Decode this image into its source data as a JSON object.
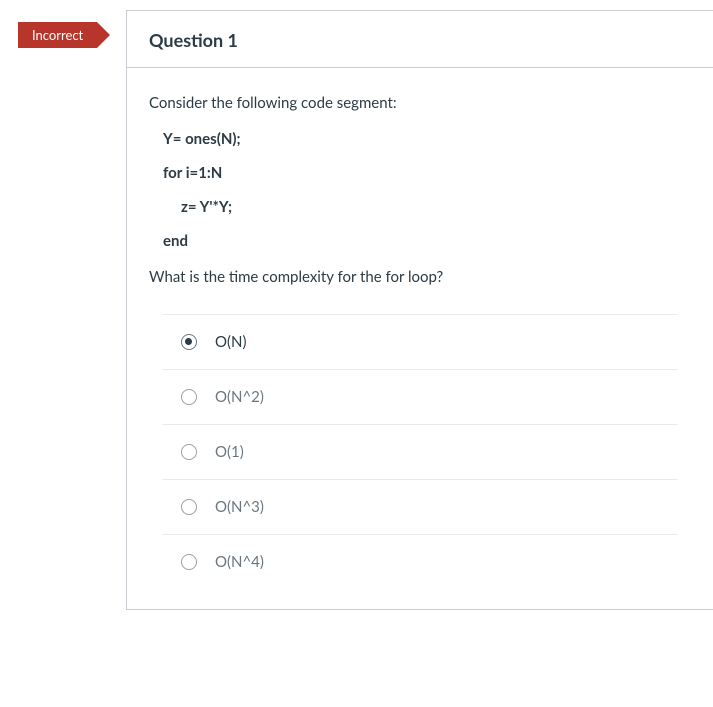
{
  "status_badge": "Incorrect",
  "question_title": "Question 1",
  "prompt_intro": "Consider the following code segment:",
  "code_lines": [
    "Y= ones(N);",
    "for i=1:N",
    "z= Y'*Y;",
    "end"
  ],
  "prompt_followup": "What is the time complexity for the for loop?",
  "answers": [
    {
      "label": "O(N)",
      "selected": true
    },
    {
      "label": "O(N^2)",
      "selected": false
    },
    {
      "label": "O(1)",
      "selected": false
    },
    {
      "label": "O(N^3)",
      "selected": false
    },
    {
      "label": "O(N^4)",
      "selected": false
    }
  ]
}
